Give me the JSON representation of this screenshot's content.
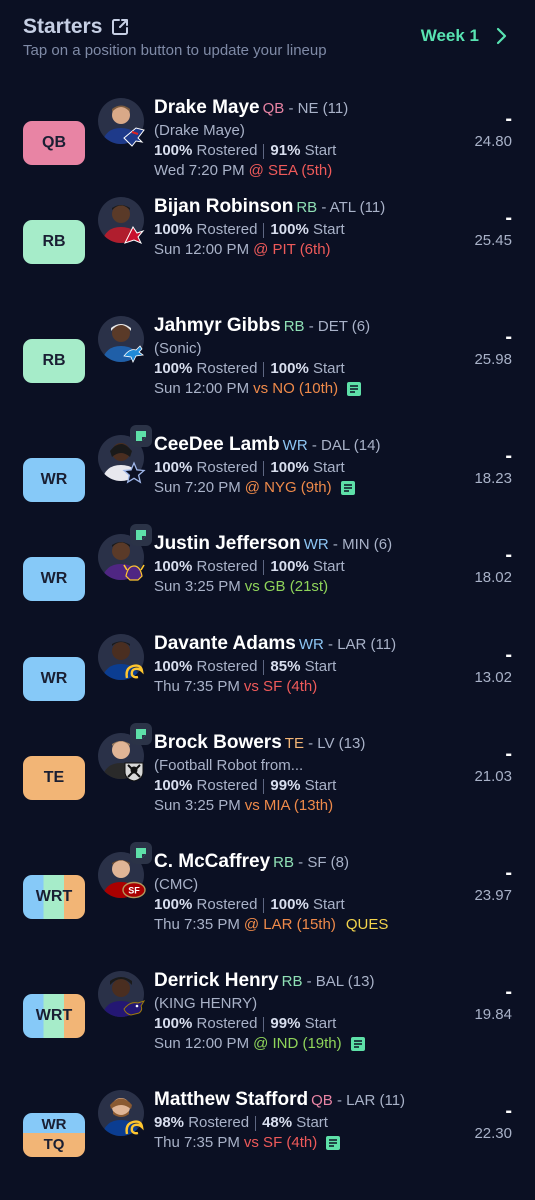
{
  "header": {
    "title": "Starters",
    "subtitle": "Tap on a position button to update your lineup",
    "week_label": "Week 1"
  },
  "colors": {
    "background": "#0b1023",
    "accent": "#58e3b2",
    "qb": "#e884a4",
    "rb": "#a6ecc9",
    "wr": "#86c9f8",
    "te": "#f2b576"
  },
  "starters": [
    {
      "slot": "QB",
      "name": "Drake Maye",
      "pos": "QB",
      "team_meta": " - NE (11)",
      "nickname": "(Drake Maye)",
      "rostered": "100%",
      "rostered_label": "Rostered",
      "start": "91%",
      "start_label": "Start",
      "game_time": "Wed 7:20 PM",
      "opponent": "@ SEA (5th)",
      "projection": "24.80",
      "points": "-",
      "status": ""
    },
    {
      "slot": "RB",
      "name": "Bijan Robinson",
      "pos": "RB",
      "team_meta": " - ATL (11)",
      "nickname": "",
      "rostered": "100%",
      "rostered_label": "Rostered",
      "start": "100%",
      "start_label": "Start",
      "game_time": "Sun 12:00 PM",
      "opponent": "@ PIT (6th)",
      "projection": "25.45",
      "points": "-",
      "status": ""
    },
    {
      "slot": "RB",
      "name": "Jahmyr Gibbs",
      "pos": "RB",
      "team_meta": " - DET (6)",
      "nickname": "(Sonic)",
      "rostered": "100%",
      "rostered_label": "Rostered",
      "start": "100%",
      "start_label": "Start",
      "game_time": "Sun 12:00 PM",
      "opponent": "vs NO (10th)",
      "projection": "25.98",
      "points": "-",
      "status": ""
    },
    {
      "slot": "WR",
      "name": "CeeDee Lamb",
      "pos": "WR",
      "team_meta": " - DAL (14)",
      "nickname": "",
      "rostered": "100%",
      "rostered_label": "Rostered",
      "start": "100%",
      "start_label": "Start",
      "game_time": "Sun 7:20 PM",
      "opponent": "@ NYG (9th)",
      "projection": "18.23",
      "points": "-",
      "status": ""
    },
    {
      "slot": "WR",
      "name": "Justin Jefferson",
      "pos": "WR",
      "team_meta": " - MIN (6)",
      "nickname": "",
      "rostered": "100%",
      "rostered_label": "Rostered",
      "start": "100%",
      "start_label": "Start",
      "game_time": "Sun 3:25 PM",
      "opponent": "vs GB (21st)",
      "projection": "18.02",
      "points": "-",
      "status": ""
    },
    {
      "slot": "WR",
      "name": "Davante Adams",
      "pos": "WR",
      "team_meta": " - LAR (11)",
      "nickname": "",
      "rostered": "100%",
      "rostered_label": "Rostered",
      "start": "85%",
      "start_label": "Start",
      "game_time": "Thu 7:35 PM",
      "opponent": "vs SF (4th)",
      "projection": "13.02",
      "points": "-",
      "status": ""
    },
    {
      "slot": "TE",
      "name": "Brock Bowers",
      "pos": "TE",
      "team_meta": " - LV (13)",
      "nickname": "(Football Robot from...",
      "rostered": "100%",
      "rostered_label": "Rostered",
      "start": "99%",
      "start_label": "Start",
      "game_time": "Sun 3:25 PM",
      "opponent": "vs MIA (13th)",
      "projection": "21.03",
      "points": "-",
      "status": ""
    },
    {
      "slot": "WRT",
      "name": "C. McCaffrey",
      "pos": "RB",
      "team_meta": " - SF (8)",
      "nickname": "(CMC)",
      "rostered": "100%",
      "rostered_label": "Rostered",
      "start": "100%",
      "start_label": "Start",
      "game_time": "Thu 7:35 PM",
      "opponent": "@ LAR (15th)",
      "projection": "23.97",
      "points": "-",
      "status": "QUES"
    },
    {
      "slot": "WRT",
      "name": "Derrick Henry",
      "pos": "RB",
      "team_meta": " - BAL (13)",
      "nickname": "(KING HENRY)",
      "rostered": "100%",
      "rostered_label": "Rostered",
      "start": "99%",
      "start_label": "Start",
      "game_time": "Sun 12:00 PM",
      "opponent": "@ IND (19th)",
      "projection": "19.84",
      "points": "-",
      "status": ""
    },
    {
      "slot_top": "WR",
      "slot_bottom": "TQ",
      "name": "Matthew Stafford",
      "pos": "QB",
      "team_meta": " - LAR (11)",
      "nickname": "",
      "rostered": "98%",
      "rostered_label": "Rostered",
      "start": "48%",
      "start_label": "Start",
      "game_time": "Thu 7:35 PM",
      "opponent": "vs SF (4th)",
      "projection": "22.30",
      "points": "-",
      "status": ""
    }
  ]
}
